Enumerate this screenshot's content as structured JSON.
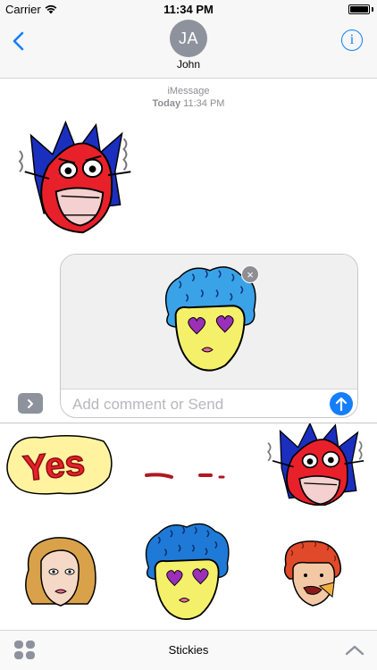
{
  "status_bar": {
    "carrier": "Carrier",
    "time": "11:34 PM",
    "battery_level": 1.0
  },
  "nav": {
    "avatar_initials": "JA",
    "contact_name": "John",
    "info_glyph": "i"
  },
  "thread": {
    "service": "iMessage",
    "day": "Today",
    "time": "11:34 PM"
  },
  "compose": {
    "placeholder": "Add comment or Send",
    "remove_glyph": "×"
  },
  "app_bar": {
    "title": "Stickies"
  },
  "icons": {
    "back": "chevron-left-icon",
    "info": "info-icon",
    "send": "arrow-up-icon",
    "expand": "chevron-right-icon",
    "apps": "app-grid-icon",
    "collapse": "chevron-up-icon",
    "wifi": "wifi-icon",
    "battery": "battery-icon"
  },
  "colors": {
    "accent": "#147efb",
    "gray": "#8e929c",
    "sticker_red": "#e8202a",
    "sticker_blue": "#1b2fbf",
    "sticker_yellow": "#f5f06a",
    "sticker_lightblue": "#3aa3e8",
    "heart_purple": "#9b2fb8"
  }
}
